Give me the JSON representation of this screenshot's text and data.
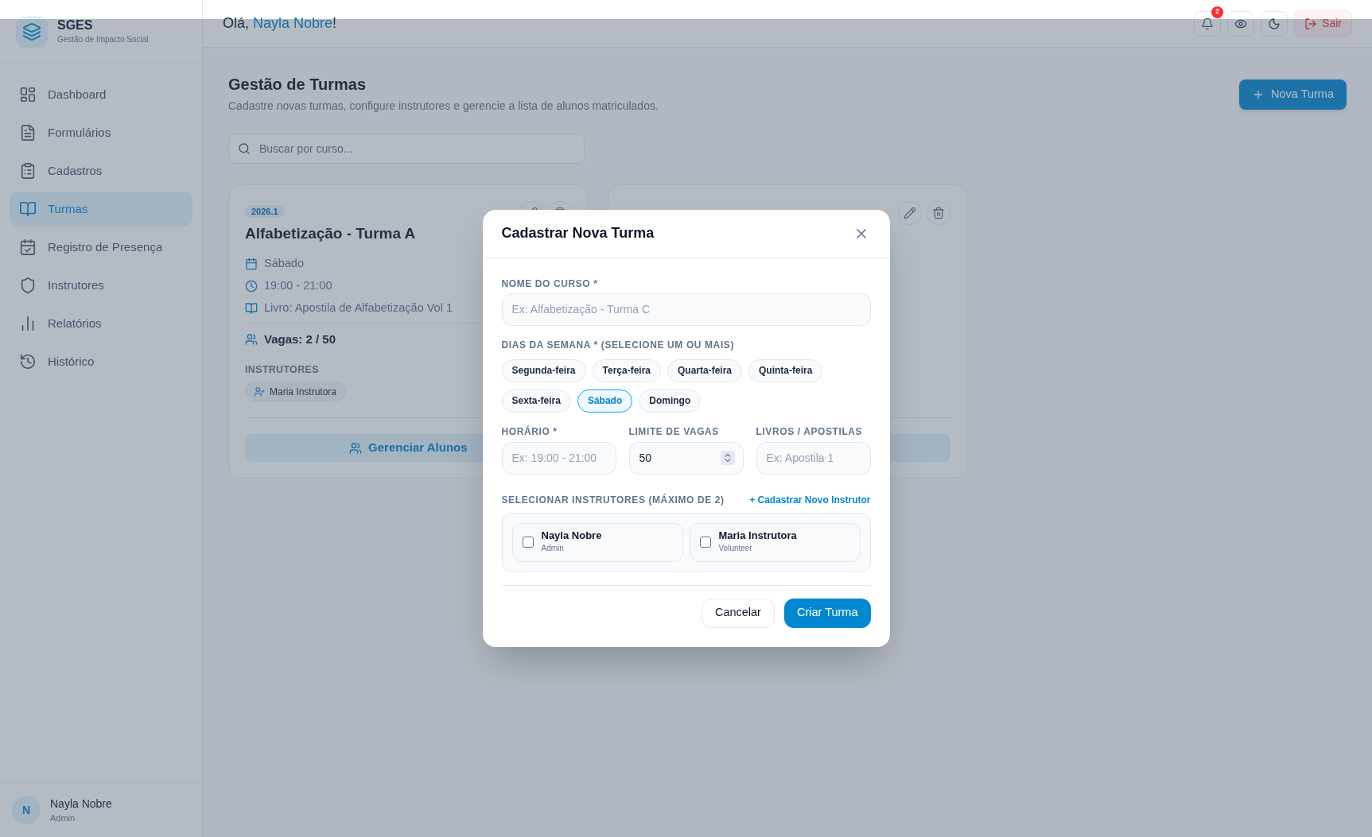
{
  "app": {
    "name": "SGES",
    "tagline": "Gestão de Impacto Social"
  },
  "sidebar": {
    "items": [
      {
        "label": "Dashboard",
        "selected": false
      },
      {
        "label": "Formulários",
        "selected": false
      },
      {
        "label": "Cadastros",
        "selected": false
      },
      {
        "label": "Turmas",
        "selected": true
      },
      {
        "label": "Registro de Presença",
        "selected": false
      },
      {
        "label": "Instrutores",
        "selected": false
      },
      {
        "label": "Relatórios",
        "selected": false
      },
      {
        "label": "Histórico",
        "selected": false
      }
    ]
  },
  "user": {
    "initial": "N",
    "name": "Nayla Nobre",
    "role": "Admin"
  },
  "header": {
    "greeting": {
      "prefix": "Olá, ",
      "name": "Nayla Nobre",
      "suffix": "!"
    },
    "notification_count": "2",
    "logout": "Sair"
  },
  "page": {
    "title": "Gestão de Turmas",
    "subtitle": "Cadastre novas turmas, configure instrutores e gerencie a lista de alunos matriculados.",
    "new_button": "Nova Turma",
    "search": {
      "placeholder": "Buscar por curso..."
    }
  },
  "cards": [
    {
      "badge": "2026.1",
      "title": "Alfabetização - Turma A",
      "details": [
        "Sábado",
        "19:00 - 21:00",
        "Livro: Apostila de Alfabetização Vol 1"
      ],
      "vacancies": "Vagas: 2 / 50",
      "instructors_label": "INSTRUTORES",
      "instructors": [
        "Maria Instrutora"
      ],
      "action": "Gerenciar Alunos"
    }
  ],
  "modal": {
    "title": "Cadastrar Nova Turma",
    "course_field": {
      "label": "NOME DO CURSO *",
      "placeholder": "Ex: Alfabetização - Turma C"
    },
    "days": {
      "label": "DIAS DA SEMANA * (SELECIONE UM OU MAIS)",
      "options": [
        {
          "label": "Segunda-feira",
          "selected": false
        },
        {
          "label": "Terça-feira",
          "selected": false
        },
        {
          "label": "Quarta-feira",
          "selected": false
        },
        {
          "label": "Quinta-feira",
          "selected": false
        },
        {
          "label": "Sexta-feira",
          "selected": false
        },
        {
          "label": "Sábado",
          "selected": true
        },
        {
          "label": "Domingo",
          "selected": false
        }
      ]
    },
    "row_fields": [
      {
        "kind": "text",
        "label": "HORÁRIO *",
        "placeholder": "Ex: 19:00 - 21:00"
      },
      {
        "kind": "number",
        "label": "LIMITE DE VAGAS",
        "value": "50"
      },
      {
        "kind": "text",
        "label": "LIVROS / APOSTILAS",
        "placeholder": "Ex: Apostila 1"
      }
    ],
    "instructors": {
      "label": "SELECIONAR INSTRUTORES (MÁXIMO DE 2)",
      "add_link": "+ Cadastrar Novo Instrutor",
      "options": [
        {
          "name": "Nayla Nobre",
          "role": "Admin",
          "checked": false
        },
        {
          "name": "Maria Instrutora",
          "role": "Volunteer",
          "checked": false
        }
      ]
    },
    "buttons": [
      {
        "kind": "secondary",
        "label": "Cancelar"
      },
      {
        "kind": "primary",
        "label": "Criar Turma"
      }
    ]
  }
}
